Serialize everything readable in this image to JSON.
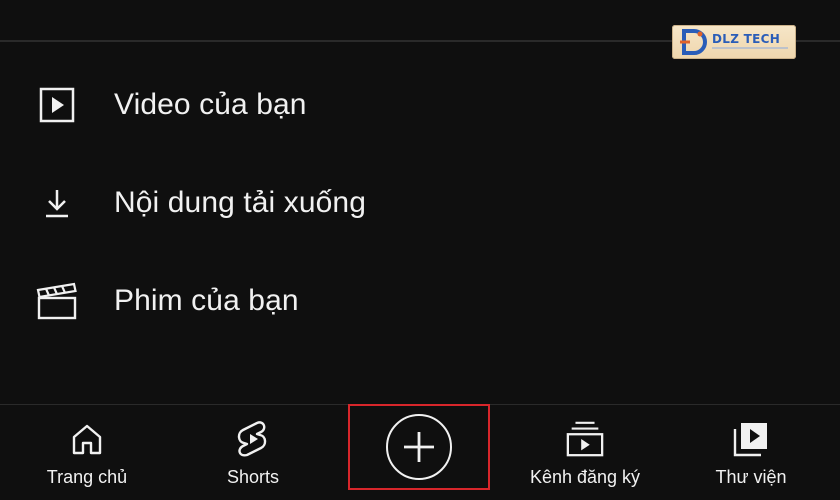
{
  "watermark": {
    "brand": "DLZ TECH"
  },
  "menu": {
    "items": [
      {
        "label": "Video của bạn",
        "icon": "play-box-icon"
      },
      {
        "label": "Nội dung tải xuống",
        "icon": "download-icon"
      },
      {
        "label": "Phim của bạn",
        "icon": "clapperboard-icon"
      }
    ]
  },
  "bottom_nav": {
    "items": [
      {
        "label": "Trang chủ",
        "icon": "home-icon"
      },
      {
        "label": "Shorts",
        "icon": "shorts-icon"
      },
      {
        "label": "",
        "icon": "create-plus-icon",
        "highlighted": true
      },
      {
        "label": "Kênh đăng ký",
        "icon": "subscriptions-icon"
      },
      {
        "label": "Thư viện",
        "icon": "library-icon"
      }
    ]
  },
  "colors": {
    "background": "#0f0f0f",
    "text": "#f1f1f1",
    "highlight_border": "#d8262b",
    "watermark_bg": "#f6e6c8",
    "watermark_text": "#2a5db8"
  }
}
